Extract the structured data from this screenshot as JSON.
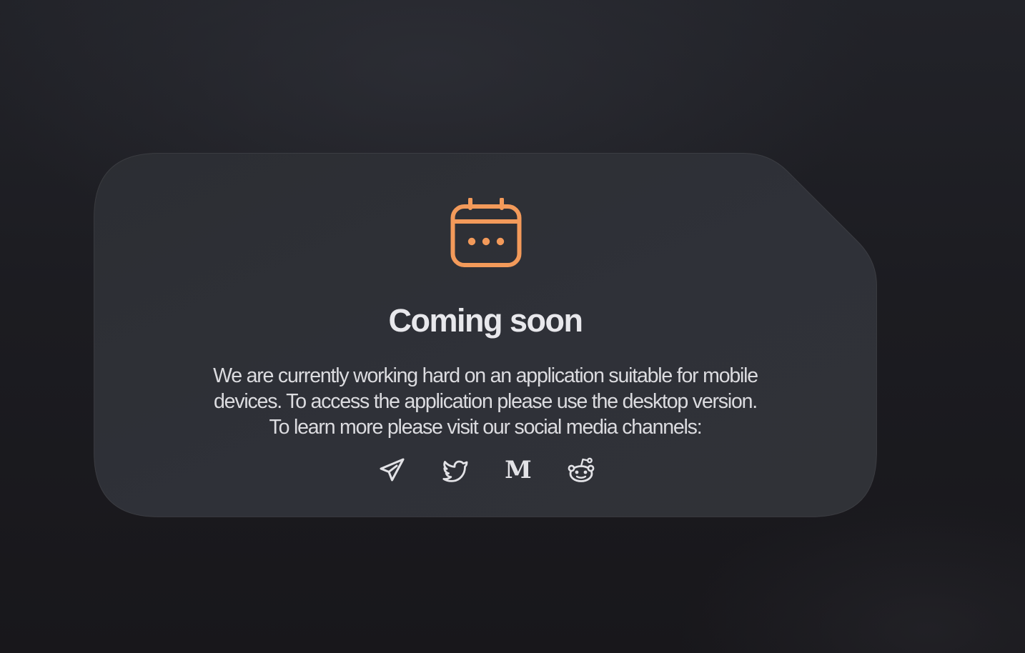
{
  "card": {
    "icon": "calendar-dots-icon",
    "title": "Coming soon",
    "message_lines": [
      "We are currently working hard on an application suitable for mobile",
      "devices. To access the application please use the desktop version.",
      "To learn more please visit our social media channels:"
    ]
  },
  "socials": [
    {
      "name": "Telegram",
      "icon": "telegram-icon"
    },
    {
      "name": "Twitter",
      "icon": "twitter-icon"
    },
    {
      "name": "Medium",
      "icon": "medium-icon",
      "glyph": "M"
    },
    {
      "name": "Reddit",
      "icon": "reddit-icon"
    }
  ],
  "colors": {
    "accent": "#f39a5a",
    "text_primary": "#e8e8ec",
    "card_background": "#2d2f35",
    "page_background": "#1c1c21"
  }
}
